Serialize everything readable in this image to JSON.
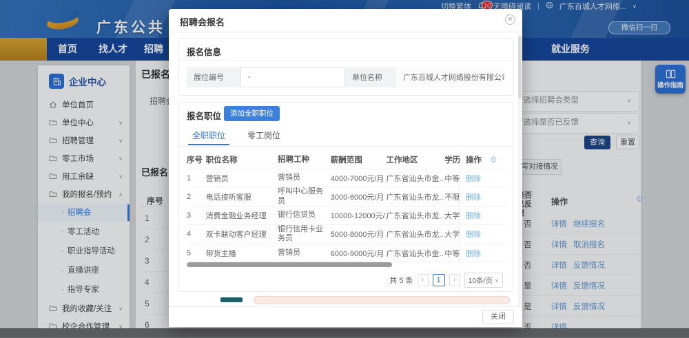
{
  "topbar": {
    "brand": "广东公共",
    "switch_traditional": "切换繁体",
    "notification_count": "10",
    "accessibility": "无障碍阅读",
    "separator": "|",
    "site_name": "广东百城人才网络...",
    "site_chevron": "∨",
    "scan_label": "微信扫一扫"
  },
  "nav": {
    "home": "首页",
    "find_talent": "找人才",
    "recruit": "招聘",
    "employment": "就业服务"
  },
  "sidebar": {
    "title": "企业中心",
    "items": [
      {
        "label": "单位首页",
        "icon": "home",
        "arrow": ""
      },
      {
        "label": "单位中心",
        "icon": "folder",
        "arrow": "v"
      },
      {
        "label": "招聘管理",
        "icon": "folder",
        "arrow": "v"
      },
      {
        "label": "零工市场",
        "icon": "folder",
        "arrow": "v"
      },
      {
        "label": "用工余缺",
        "icon": "folder",
        "arrow": "v"
      },
      {
        "label": "我的报名/预约",
        "icon": "folder",
        "arrow": "up",
        "children": [
          "招聘会",
          "零工活动",
          "职业指导活动",
          "直播讲座",
          "指导专家"
        ],
        "active_child": "招聘会"
      },
      {
        "label": "我的收藏/关注",
        "icon": "folder",
        "arrow": "v"
      },
      {
        "label": "校企合作管理",
        "icon": "folder",
        "arrow": "v"
      }
    ]
  },
  "background": {
    "page_title": "已报名招聘会",
    "field_label": "招聘会",
    "section_title": "已报名",
    "seq_header": "序号",
    "row_numbers": [
      "1",
      "2",
      "3",
      "4",
      "5",
      "6"
    ],
    "type_select_placeholder": "请选择招聘会类型",
    "feedback_select_placeholder": "请选择是否已反馈",
    "query_button": "查询",
    "reset_button": "重置",
    "feedback_tab": "填写对接情况",
    "feedback_col_header": "是否已反馈",
    "action_col_header": "操作",
    "rows": [
      {
        "feedback": "否",
        "actions": [
          "详情",
          "继续报名"
        ]
      },
      {
        "feedback": "否",
        "actions": [
          "详情",
          "取消报名"
        ]
      },
      {
        "feedback": "否",
        "actions": [
          "详情",
          "反馈情况"
        ]
      },
      {
        "feedback": "是",
        "actions": [
          "详情",
          "反馈情况"
        ]
      },
      {
        "feedback": "是",
        "actions": [
          "详情",
          "反馈情况"
        ]
      },
      {
        "feedback": "否",
        "actions": [
          "详情"
        ]
      }
    ],
    "guide_button": "操作指南"
  },
  "modal": {
    "title": "招聘会报名",
    "info_section": {
      "title": "报名信息",
      "booth_label": "展位编号",
      "booth_value": "-",
      "company_label": "单位名称",
      "company_value": "广东百城人才网络股份有限公司"
    },
    "position_section": {
      "title": "报名职位",
      "add_button": "添加全职职位",
      "tabs": [
        "全职职位",
        "零工岗位"
      ],
      "active_tab": "全职职位",
      "table": {
        "headers": [
          "序号",
          "职位名称",
          "招聘工种",
          "薪酬范围",
          "工作地区",
          "学历要求",
          "操作"
        ],
        "delete_label": "删除",
        "rows": [
          {
            "seq": "1",
            "name": "营销员",
            "type": "营销员",
            "salary": "4000-7000元/月",
            "area": "广东省汕头市金...",
            "edu": "中等"
          },
          {
            "seq": "2",
            "name": "电话接听客服",
            "type": "呼叫中心服务员",
            "salary": "3000-6000元/月",
            "area": "广东省汕头市龙...",
            "edu": "不限"
          },
          {
            "seq": "3",
            "name": "消费金融业务经理",
            "type": "银行信贷员",
            "salary": "10000-12000元/...",
            "area": "广东省汕头市龙...",
            "edu": "大学"
          },
          {
            "seq": "4",
            "name": "双卡联动客户经理",
            "type": "银行信用卡业务员",
            "salary": "5000-8000元/月",
            "area": "广东省汕头市龙...",
            "edu": "大学"
          },
          {
            "seq": "5",
            "name": "带货主播",
            "type": "营销员",
            "salary": "6000-9000元/月",
            "area": "广东省汕头市金...",
            "edu": "中等"
          }
        ]
      },
      "pagination": {
        "total": "共 5 条",
        "prev": "‹",
        "page": "1",
        "next": "›",
        "size": "10条/页"
      }
    },
    "close_button": "关闭"
  }
}
